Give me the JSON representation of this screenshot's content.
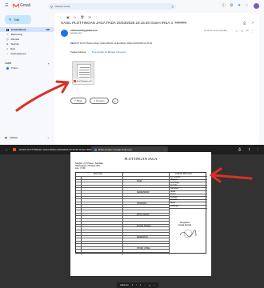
{
  "gmail": {
    "app_name": "Gmail",
    "search_placeholder": "Telusuri email",
    "compose_label": "Tulis",
    "sidebar": [
      {
        "label": "Kotak Masuk",
        "count": "996",
        "active": true,
        "icon": "inbox-icon"
      },
      {
        "label": "Berbintang",
        "icon": "star-icon"
      },
      {
        "label": "Ditunda",
        "icon": "clock-icon"
      },
      {
        "label": "Terkirim",
        "icon": "send-icon"
      },
      {
        "label": "Draf",
        "icon": "draft-icon"
      },
      {
        "label": "Selengkapnya",
        "icon": "chevron-down-icon"
      }
    ],
    "labels_heading": "Label",
    "label_items": [
      {
        "label": "Promo"
      }
    ],
    "apps_label": "Aplikasi",
    "subject": "HASIL PLOTTINGAN JAGA PADA 24/03/2025 23:15:40 OLEH IRSA 4",
    "subject_badge": "Kotak Masuk",
    "sender": "sinbamonit@gmail.com",
    "to": "kepada saya",
    "date": "20.15 (12 menit yang lalu)",
    "body": "BERIKUT PLOTTINGAN JAGA YANG DIBUAT OLEH IRSA 4 PADA 24/03/2025 23:15:40",
    "translate_from": "Pelajari bahasa",
    "translate_to": "Terjemahkan ke Bahasa Indonesia",
    "attachment_name": "Hasil Plottingan...pdf",
    "reply_label": "Balas",
    "forward_label": "Teruskan"
  },
  "viewer": {
    "file_title": "HASIL PLOTTINGAN JAGA PADA 24/03/2025 23:15:40 OLEH IRSA 4.pdf",
    "tab_label": "Buka dengan Google Dokumen",
    "page_label": "Halaman",
    "page_current": "1",
    "page_sep": "/",
    "page_total": "1",
    "doc": {
      "title": "PLOTTINGAN JAGA",
      "meta": [
        "Sekolah : A.P. Polnes - Sambalai",
        "Hari/Tanggal : 25 Maret 2025",
        "Jam : 07.00"
      ],
      "left_head": "PETUGAS",
      "mid_sections": [
        "PIKET",
        "SEKRETARIAT",
        "KONSUMSI",
        "PINTU MASUK",
        "RUANG SIDANG",
        "KESEHATAN",
        "POSKO UTAMA"
      ],
      "right_head": "JUMLAH PETUGAS",
      "right_rows": [
        "Ka. Sekolah",
        "Wakasek",
        "Guru Piket",
        "Security",
        "Karyawan",
        "Siswa",
        "Dokter",
        "Perawat",
        "Ambulan",
        "Driver",
        "Cadangan"
      ],
      "signature_label": "Mengetahui",
      "signature_title": "Kepala Sekolah"
    }
  }
}
